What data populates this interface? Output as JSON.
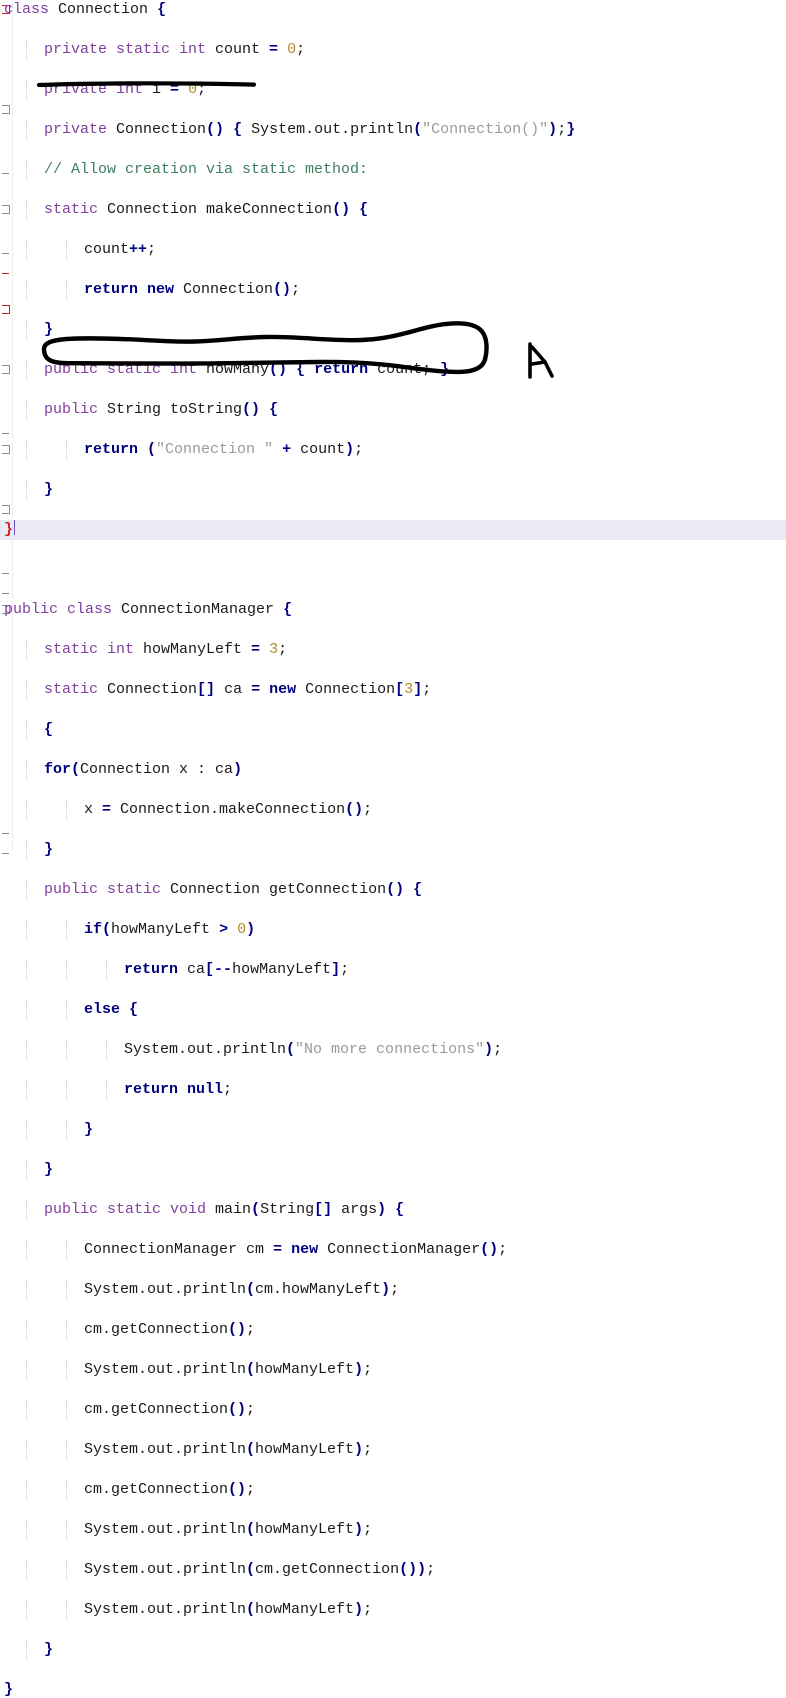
{
  "editor": {
    "language": "java",
    "background": "#ffffff",
    "current_line_highlight": "#eaeaf7",
    "font_size_px": 15,
    "line_height_px": 20,
    "colors": {
      "modifier_keyword": "#7f3f9e",
      "control_keyword": "#000080",
      "string_literal": "#9a9a9a",
      "number_literal": "#b58a2b",
      "comment": "#3f7f5f",
      "plain_text": "#1a1a1a",
      "unmatched_brace": "#cc2222",
      "caret": "#6a55c8",
      "annotation_ink": "#000000"
    }
  },
  "code_lines": [
    {
      "n": 1,
      "indent": 0,
      "fold": "start-red",
      "tokens": [
        {
          "t": "class",
          "c": "mod"
        },
        {
          "t": " ",
          "c": "plain"
        },
        {
          "t": "Connection",
          "c": "plain"
        },
        {
          "t": " ",
          "c": "plain"
        },
        {
          "t": "{",
          "c": "brace"
        }
      ]
    },
    {
      "n": 2,
      "indent": 1,
      "tokens": [
        {
          "t": "private static int",
          "c": "mod"
        },
        {
          "t": " count ",
          "c": "plain"
        },
        {
          "t": "=",
          "c": "op"
        },
        {
          "t": " ",
          "c": "plain"
        },
        {
          "t": "0",
          "c": "num"
        },
        {
          "t": ";",
          "c": "plain"
        }
      ]
    },
    {
      "n": 3,
      "indent": 1,
      "tokens": [
        {
          "t": "private int",
          "c": "mod"
        },
        {
          "t": " i ",
          "c": "plain"
        },
        {
          "t": "=",
          "c": "op"
        },
        {
          "t": " ",
          "c": "plain"
        },
        {
          "t": "0",
          "c": "num"
        },
        {
          "t": ";",
          "c": "plain"
        }
      ]
    },
    {
      "n": 4,
      "indent": 1,
      "tokens": [
        {
          "t": "private",
          "c": "mod"
        },
        {
          "t": " Connection",
          "c": "plain"
        },
        {
          "t": "()",
          "c": "brace"
        },
        {
          "t": " ",
          "c": "plain"
        },
        {
          "t": "{",
          "c": "brace"
        },
        {
          "t": " System.out.println",
          "c": "plain"
        },
        {
          "t": "(",
          "c": "brace"
        },
        {
          "t": "\"Connection()\"",
          "c": "str"
        },
        {
          "t": ")",
          "c": "brace"
        },
        {
          "t": ";",
          "c": "plain"
        },
        {
          "t": "}",
          "c": "brace"
        }
      ]
    },
    {
      "n": 5,
      "indent": 1,
      "tokens": [
        {
          "t": "// Allow creation via static method:",
          "c": "cmt"
        }
      ]
    },
    {
      "n": 6,
      "indent": 1,
      "fold": "start",
      "tokens": [
        {
          "t": "static",
          "c": "mod"
        },
        {
          "t": " Connection makeConnection",
          "c": "plain"
        },
        {
          "t": "()",
          "c": "brace"
        },
        {
          "t": " ",
          "c": "plain"
        },
        {
          "t": "{",
          "c": "brace"
        }
      ]
    },
    {
      "n": 7,
      "indent": 2,
      "tokens": [
        {
          "t": "count",
          "c": "plain"
        },
        {
          "t": "++",
          "c": "op"
        },
        {
          "t": ";",
          "c": "plain"
        }
      ]
    },
    {
      "n": 8,
      "indent": 2,
      "tokens": [
        {
          "t": "return new",
          "c": "kw"
        },
        {
          "t": " Connection",
          "c": "plain"
        },
        {
          "t": "()",
          "c": "brace"
        },
        {
          "t": ";",
          "c": "plain"
        }
      ]
    },
    {
      "n": 9,
      "indent": 1,
      "fold": "end",
      "tokens": [
        {
          "t": "}",
          "c": "brace"
        }
      ]
    },
    {
      "n": 10,
      "indent": 1,
      "tokens": [
        {
          "t": "public static int",
          "c": "mod"
        },
        {
          "t": " howMany",
          "c": "plain"
        },
        {
          "t": "()",
          "c": "brace"
        },
        {
          "t": " ",
          "c": "plain"
        },
        {
          "t": "{",
          "c": "brace"
        },
        {
          "t": " ",
          "c": "plain"
        },
        {
          "t": "return",
          "c": "kw"
        },
        {
          "t": " count; ",
          "c": "plain"
        },
        {
          "t": "}",
          "c": "brace"
        }
      ]
    },
    {
      "n": 11,
      "indent": 1,
      "fold": "start",
      "tokens": [
        {
          "t": "public",
          "c": "mod"
        },
        {
          "t": " String toString",
          "c": "plain"
        },
        {
          "t": "()",
          "c": "brace"
        },
        {
          "t": " ",
          "c": "plain"
        },
        {
          "t": "{",
          "c": "brace"
        }
      ]
    },
    {
      "n": 12,
      "indent": 2,
      "tokens": [
        {
          "t": "return",
          "c": "kw"
        },
        {
          "t": " ",
          "c": "plain"
        },
        {
          "t": "(",
          "c": "brace"
        },
        {
          "t": "\"Connection \"",
          "c": "str"
        },
        {
          "t": " ",
          "c": "plain"
        },
        {
          "t": "+",
          "c": "op"
        },
        {
          "t": " count",
          "c": "plain"
        },
        {
          "t": ")",
          "c": "brace"
        },
        {
          "t": ";",
          "c": "plain"
        }
      ]
    },
    {
      "n": 13,
      "indent": 1,
      "fold": "end",
      "tokens": [
        {
          "t": "}",
          "c": "brace"
        }
      ]
    },
    {
      "n": 14,
      "indent": 0,
      "fold": "end-red",
      "current": true,
      "caret": true,
      "tokens": [
        {
          "t": "}",
          "c": "redbrace"
        }
      ]
    },
    {
      "n": 15,
      "indent": 0,
      "tokens": []
    },
    {
      "n": 16,
      "indent": 0,
      "fold": "start-red",
      "tokens": [
        {
          "t": "public class",
          "c": "mod"
        },
        {
          "t": " ConnectionManager",
          "c": "plain"
        },
        {
          "t": " ",
          "c": "plain"
        },
        {
          "t": "{",
          "c": "brace"
        }
      ]
    },
    {
      "n": 17,
      "indent": 1,
      "tokens": [
        {
          "t": "static int",
          "c": "mod"
        },
        {
          "t": " howManyLeft ",
          "c": "plain"
        },
        {
          "t": "=",
          "c": "op"
        },
        {
          "t": " ",
          "c": "plain"
        },
        {
          "t": "3",
          "c": "num"
        },
        {
          "t": ";",
          "c": "plain"
        }
      ]
    },
    {
      "n": 18,
      "indent": 1,
      "annotated": "circled",
      "tokens": [
        {
          "t": "static",
          "c": "mod"
        },
        {
          "t": " Connection",
          "c": "plain"
        },
        {
          "t": "[]",
          "c": "brace"
        },
        {
          "t": " ca ",
          "c": "plain"
        },
        {
          "t": "=",
          "c": "op"
        },
        {
          "t": " ",
          "c": "plain"
        },
        {
          "t": "new",
          "c": "kw"
        },
        {
          "t": " Connection",
          "c": "plain"
        },
        {
          "t": "[",
          "c": "brace"
        },
        {
          "t": "3",
          "c": "num"
        },
        {
          "t": "]",
          "c": "brace"
        },
        {
          "t": ";",
          "c": "plain"
        }
      ]
    },
    {
      "n": 19,
      "indent": 1,
      "fold": "start",
      "tokens": [
        {
          "t": "{",
          "c": "brace"
        }
      ]
    },
    {
      "n": 20,
      "indent": 1,
      "tokens": [
        {
          "t": "for",
          "c": "kw"
        },
        {
          "t": "(",
          "c": "brace"
        },
        {
          "t": "Connection x : ca",
          "c": "plain"
        },
        {
          "t": ")",
          "c": "brace"
        }
      ]
    },
    {
      "n": 21,
      "indent": 2,
      "tokens": [
        {
          "t": "x ",
          "c": "plain"
        },
        {
          "t": "=",
          "c": "op"
        },
        {
          "t": " Connection.makeConnection",
          "c": "plain"
        },
        {
          "t": "()",
          "c": "brace"
        },
        {
          "t": ";",
          "c": "plain"
        }
      ]
    },
    {
      "n": 22,
      "indent": 1,
      "fold": "end",
      "tokens": [
        {
          "t": "}",
          "c": "brace"
        }
      ]
    },
    {
      "n": 23,
      "indent": 1,
      "fold": "start",
      "tokens": [
        {
          "t": "public static",
          "c": "mod"
        },
        {
          "t": " Connection getConnection",
          "c": "plain"
        },
        {
          "t": "()",
          "c": "brace"
        },
        {
          "t": " ",
          "c": "plain"
        },
        {
          "t": "{",
          "c": "brace"
        }
      ]
    },
    {
      "n": 24,
      "indent": 2,
      "tokens": [
        {
          "t": "if",
          "c": "kw"
        },
        {
          "t": "(",
          "c": "brace"
        },
        {
          "t": "howManyLeft ",
          "c": "plain"
        },
        {
          "t": ">",
          "c": "op"
        },
        {
          "t": " ",
          "c": "plain"
        },
        {
          "t": "0",
          "c": "num"
        },
        {
          "t": ")",
          "c": "brace"
        }
      ]
    },
    {
      "n": 25,
      "indent": 3,
      "tokens": [
        {
          "t": "return",
          "c": "kw"
        },
        {
          "t": " ca",
          "c": "plain"
        },
        {
          "t": "[",
          "c": "brace"
        },
        {
          "t": "--",
          "c": "op"
        },
        {
          "t": "howManyLeft",
          "c": "plain"
        },
        {
          "t": "]",
          "c": "brace"
        },
        {
          "t": ";",
          "c": "plain"
        }
      ]
    },
    {
      "n": 26,
      "indent": 2,
      "fold": "start",
      "tokens": [
        {
          "t": "else",
          "c": "kw"
        },
        {
          "t": " ",
          "c": "plain"
        },
        {
          "t": "{",
          "c": "brace"
        }
      ]
    },
    {
      "n": 27,
      "indent": 3,
      "tokens": [
        {
          "t": "System.out.println",
          "c": "plain"
        },
        {
          "t": "(",
          "c": "brace"
        },
        {
          "t": "\"No more connections\"",
          "c": "str"
        },
        {
          "t": ")",
          "c": "brace"
        },
        {
          "t": ";",
          "c": "plain"
        }
      ]
    },
    {
      "n": 28,
      "indent": 3,
      "tokens": [
        {
          "t": "return null",
          "c": "kw"
        },
        {
          "t": ";",
          "c": "plain"
        }
      ]
    },
    {
      "n": 29,
      "indent": 2,
      "fold": "end",
      "tokens": [
        {
          "t": "}",
          "c": "brace"
        }
      ]
    },
    {
      "n": 30,
      "indent": 1,
      "fold": "end",
      "tokens": [
        {
          "t": "}",
          "c": "brace"
        }
      ]
    },
    {
      "n": 31,
      "indent": 1,
      "fold": "start",
      "tokens": [
        {
          "t": "public static void",
          "c": "mod"
        },
        {
          "t": " main",
          "c": "plain"
        },
        {
          "t": "(",
          "c": "brace"
        },
        {
          "t": "String",
          "c": "plain"
        },
        {
          "t": "[]",
          "c": "brace"
        },
        {
          "t": " args",
          "c": "plain"
        },
        {
          "t": ")",
          "c": "brace"
        },
        {
          "t": " ",
          "c": "plain"
        },
        {
          "t": "{",
          "c": "brace"
        }
      ]
    },
    {
      "n": 32,
      "indent": 2,
      "tokens": [
        {
          "t": "ConnectionManager cm ",
          "c": "plain"
        },
        {
          "t": "=",
          "c": "op"
        },
        {
          "t": " ",
          "c": "plain"
        },
        {
          "t": "new",
          "c": "kw"
        },
        {
          "t": " ConnectionManager",
          "c": "plain"
        },
        {
          "t": "()",
          "c": "brace"
        },
        {
          "t": ";",
          "c": "plain"
        }
      ]
    },
    {
      "n": 33,
      "indent": 2,
      "tokens": [
        {
          "t": "System.out.println",
          "c": "plain"
        },
        {
          "t": "(",
          "c": "brace"
        },
        {
          "t": "cm.howManyLeft",
          "c": "plain"
        },
        {
          "t": ")",
          "c": "brace"
        },
        {
          "t": ";",
          "c": "plain"
        }
      ]
    },
    {
      "n": 34,
      "indent": 2,
      "tokens": [
        {
          "t": "cm.getConnection",
          "c": "plain"
        },
        {
          "t": "()",
          "c": "brace"
        },
        {
          "t": ";",
          "c": "plain"
        }
      ]
    },
    {
      "n": 35,
      "indent": 2,
      "tokens": [
        {
          "t": "System.out.println",
          "c": "plain"
        },
        {
          "t": "(",
          "c": "brace"
        },
        {
          "t": "howManyLeft",
          "c": "plain"
        },
        {
          "t": ")",
          "c": "brace"
        },
        {
          "t": ";",
          "c": "plain"
        }
      ]
    },
    {
      "n": 36,
      "indent": 2,
      "tokens": [
        {
          "t": "cm.getConnection",
          "c": "plain"
        },
        {
          "t": "()",
          "c": "brace"
        },
        {
          "t": ";",
          "c": "plain"
        }
      ]
    },
    {
      "n": 37,
      "indent": 2,
      "tokens": [
        {
          "t": "System.out.println",
          "c": "plain"
        },
        {
          "t": "(",
          "c": "brace"
        },
        {
          "t": "howManyLeft",
          "c": "plain"
        },
        {
          "t": ")",
          "c": "brace"
        },
        {
          "t": ";",
          "c": "plain"
        }
      ]
    },
    {
      "n": 38,
      "indent": 2,
      "tokens": [
        {
          "t": "cm.getConnection",
          "c": "plain"
        },
        {
          "t": "()",
          "c": "brace"
        },
        {
          "t": ";",
          "c": "plain"
        }
      ]
    },
    {
      "n": 39,
      "indent": 2,
      "tokens": [
        {
          "t": "System.out.println",
          "c": "plain"
        },
        {
          "t": "(",
          "c": "brace"
        },
        {
          "t": "howManyLeft",
          "c": "plain"
        },
        {
          "t": ")",
          "c": "brace"
        },
        {
          "t": ";",
          "c": "plain"
        }
      ]
    },
    {
      "n": 40,
      "indent": 2,
      "tokens": [
        {
          "t": "System.out.println",
          "c": "plain"
        },
        {
          "t": "(",
          "c": "brace"
        },
        {
          "t": "cm.getConnection",
          "c": "plain"
        },
        {
          "t": "()",
          "c": "brace"
        },
        {
          "t": ")",
          "c": "brace"
        },
        {
          "t": ";",
          "c": "plain"
        }
      ]
    },
    {
      "n": 41,
      "indent": 2,
      "tokens": [
        {
          "t": "System.out.println",
          "c": "plain"
        },
        {
          "t": "(",
          "c": "brace"
        },
        {
          "t": "howManyLeft",
          "c": "plain"
        },
        {
          "t": ")",
          "c": "brace"
        },
        {
          "t": ";",
          "c": "plain"
        }
      ]
    },
    {
      "n": 42,
      "indent": 1,
      "fold": "end",
      "tokens": [
        {
          "t": "}",
          "c": "brace"
        }
      ]
    },
    {
      "n": 43,
      "indent": 0,
      "fold": "end",
      "tokens": [
        {
          "t": "}",
          "c": "brace"
        }
      ]
    }
  ],
  "annotations": [
    {
      "id": "underline-private-constructor",
      "kind": "underline",
      "ink": "#000000",
      "targets_line": 4,
      "note": "thick hand drawn horizontal line under 'private Connection()'"
    },
    {
      "id": "ellipse-connection-array",
      "kind": "ellipse",
      "ink": "#000000",
      "targets_line": 18,
      "note": "hand drawn oval circling 'static Connection[] ca = new Connection[3];'"
    },
    {
      "id": "arrow-mark",
      "kind": "arrow-mark",
      "ink": "#000000",
      "note": "hand drawn vertical stroke with arrowhead to the right of the circled line"
    }
  ]
}
